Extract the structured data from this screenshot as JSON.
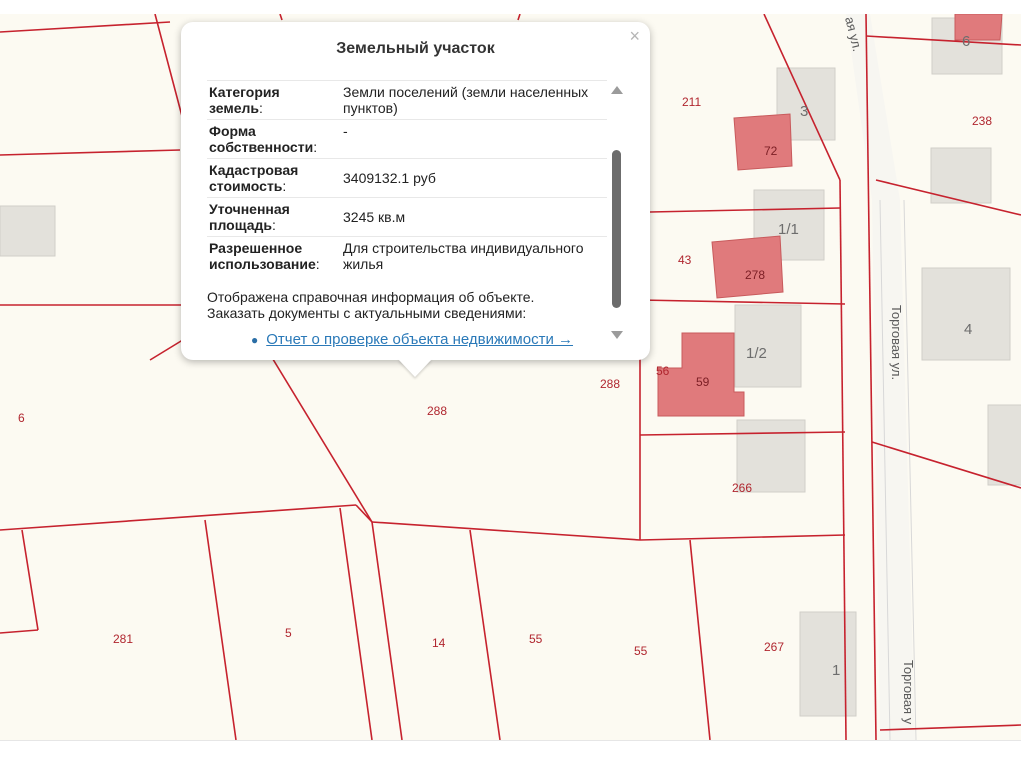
{
  "popup": {
    "title": "Земельный участок",
    "close_symbol": "×",
    "rows": [
      {
        "key_line1": "Категория",
        "key_line2": "земель",
        "value": "Земли поселений (земли населенных пунктов)"
      },
      {
        "key_line1": "Форма",
        "key_line2": "собственности",
        "value": "-"
      },
      {
        "key_line1": "Кадастровая",
        "key_line2": "стоимость",
        "value": "3409132.1 руб"
      },
      {
        "key_line1": "Уточненная",
        "key_line2": "площадь",
        "value": "3245 кв.м"
      },
      {
        "key_line1": "Разрешенное",
        "key_line2": "использование",
        "value": "Для строительства индивидуального жилья"
      }
    ],
    "key_suffix": ":",
    "note_line1": "Отображена справочная информация об объекте.",
    "note_line2": "Заказать документы с актуальными сведениями:",
    "link_text": "Отчет о проверке объекта недвижимости →",
    "scroll_up_icon": "triangle-up-icon",
    "scroll_down_icon": "triangle-down-icon"
  },
  "map": {
    "plot_numbers": {
      "p211": "211",
      "p238": "238",
      "p43": "43",
      "p288a": "288",
      "p288b": "288",
      "p56": "56",
      "p6": "6",
      "p266": "266",
      "p281": "281",
      "p5": "5",
      "p14": "14",
      "p55a": "55",
      "p55b": "55",
      "p267": "267"
    },
    "building_labels": {
      "b3": "3",
      "b6": "6",
      "b11": "1/1",
      "b12": "1/2",
      "b4": "4",
      "b1": "1"
    },
    "red_building_labels": {
      "r72": "72",
      "r278": "278",
      "r59": "59"
    },
    "streets": {
      "torgovaya_mid": "Торговая ул.",
      "torgovaya_bottom": "Торговая у",
      "top_street": "ая ул."
    },
    "colors": {
      "background": "#fcfaf2",
      "boundary": "#c6222e",
      "building": "#e4e2dc",
      "red_building": "#e07a7c"
    }
  }
}
